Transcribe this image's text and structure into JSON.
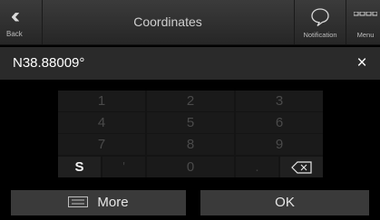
{
  "header": {
    "back_label": "Back",
    "title": "Coordinates",
    "notification_label": "Notification",
    "menu_label": "Menu"
  },
  "input": {
    "value": "N38.88009°",
    "clear_glyph": "×"
  },
  "keypad": {
    "rows": [
      [
        "1",
        "2",
        "3"
      ],
      [
        "4",
        "5",
        "6"
      ],
      [
        "7",
        "8",
        "9"
      ],
      [
        "S",
        "'",
        "0",
        ".",
        "backspace"
      ]
    ]
  },
  "footer": {
    "more_label": "More",
    "ok_label": "OK"
  },
  "colors": {
    "background": "#000000",
    "header": "#2e2e2e",
    "key_active": "#f2f2f2",
    "key_inactive": "#4a4a4a"
  }
}
